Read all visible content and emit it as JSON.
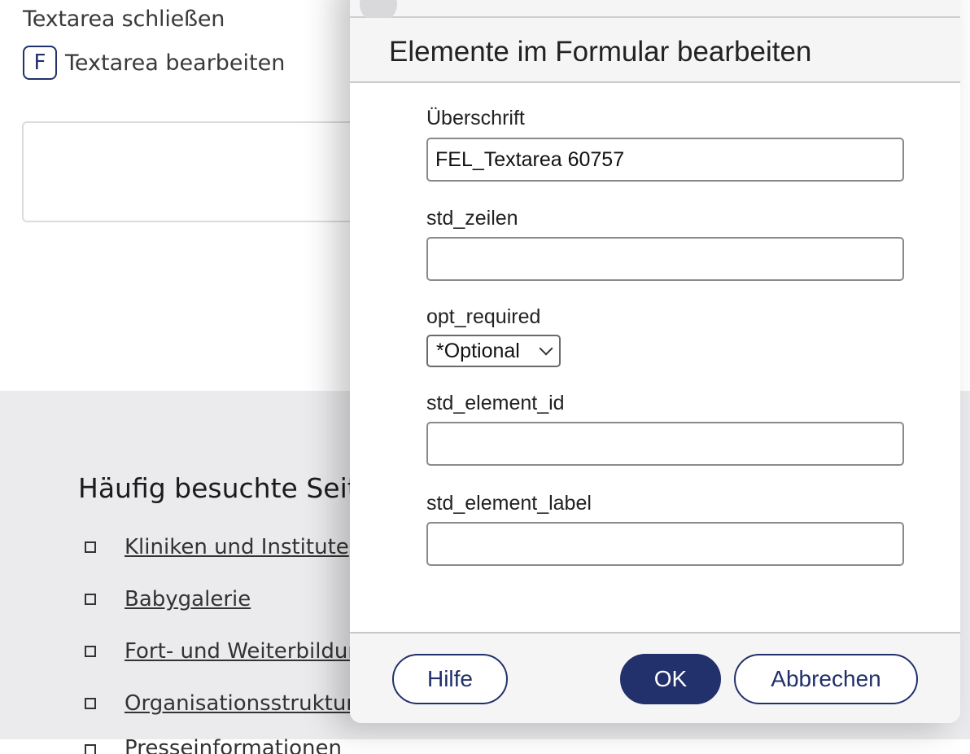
{
  "background_page": {
    "close_link": "Textarea schließen",
    "edit_badge": "F",
    "edit_label": "Textarea bearbeiten",
    "footer": {
      "heading": "Häufig besuchte Seite",
      "links": [
        "Kliniken und Institute",
        "Babygalerie",
        "Fort- und Weiterbildung",
        "Organisationsstruktur",
        "Presseinformationen"
      ]
    }
  },
  "modal": {
    "title": "Elemente im Formular bearbeiten",
    "fields": {
      "heading": {
        "label": "Überschrift",
        "value": "FEL_Textarea 60757"
      },
      "rows": {
        "label": "std_zeilen",
        "value": ""
      },
      "required": {
        "label": "opt_required",
        "selected": "*Optional"
      },
      "element_id": {
        "label": "std_element_id",
        "value": ""
      },
      "element_label": {
        "label": "std_element_label",
        "value": ""
      }
    },
    "buttons": {
      "help": "Hilfe",
      "ok": "OK",
      "cancel": "Abbrechen"
    }
  },
  "colors": {
    "primary": "#22306b",
    "footer_bg": "#ebebed",
    "modal_bar": "#f5f5f6"
  }
}
